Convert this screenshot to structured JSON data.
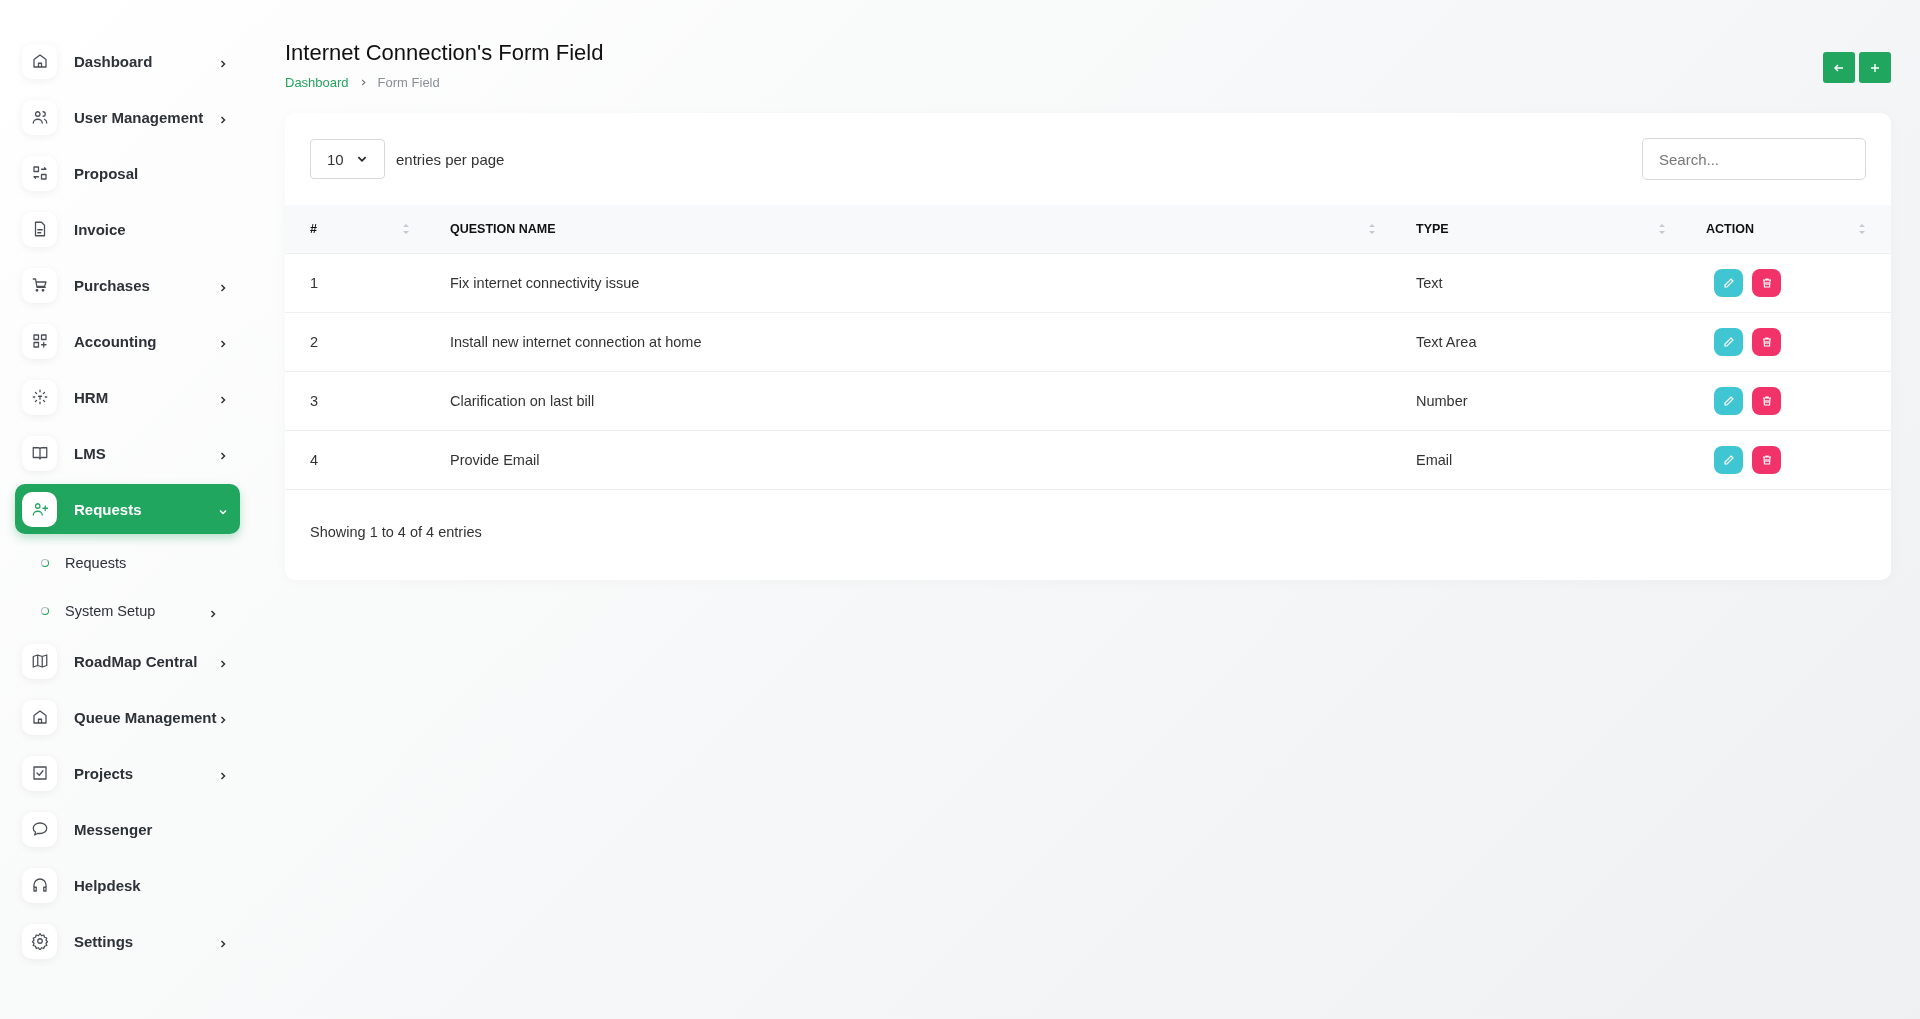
{
  "sidebar": {
    "items": [
      {
        "label": "Dashboard",
        "chevron": true,
        "selected": false
      },
      {
        "label": "User Management",
        "chevron": true,
        "selected": false
      },
      {
        "label": "Proposal",
        "chevron": false,
        "selected": false
      },
      {
        "label": "Invoice",
        "chevron": false,
        "selected": false
      },
      {
        "label": "Purchases",
        "chevron": true,
        "selected": false
      },
      {
        "label": "Accounting",
        "chevron": true,
        "selected": false
      },
      {
        "label": "HRM",
        "chevron": true,
        "selected": false
      },
      {
        "label": "LMS",
        "chevron": true,
        "selected": false
      },
      {
        "label": "Requests",
        "chevron": true,
        "selected": true,
        "expanded": true,
        "children": [
          {
            "label": "Requests",
            "chevron": false
          },
          {
            "label": "System Setup",
            "chevron": true
          }
        ]
      },
      {
        "label": "RoadMap Central",
        "chevron": true,
        "selected": false
      },
      {
        "label": "Queue Management",
        "chevron": true,
        "selected": false
      },
      {
        "label": "Projects",
        "chevron": true,
        "selected": false
      },
      {
        "label": "Messenger",
        "chevron": false,
        "selected": false
      },
      {
        "label": "Helpdesk",
        "chevron": false,
        "selected": false
      },
      {
        "label": "Settings",
        "chevron": true,
        "selected": false
      }
    ]
  },
  "page": {
    "title": "Internet Connection's Form Field",
    "breadcrumb": [
      "Dashboard",
      "Form Field"
    ]
  },
  "table_controls": {
    "page_size": "10",
    "page_size_label": "entries per page",
    "search": {
      "placeholder": "Search..."
    }
  },
  "table": {
    "columns": [
      "#",
      "QUESTION NAME",
      "TYPE",
      "ACTION"
    ],
    "rows": [
      {
        "number": "1",
        "question": "Fix internet connectivity issue",
        "type": "Text"
      },
      {
        "number": "2",
        "question": "Install new internet connection at home",
        "type": "Text Area"
      },
      {
        "number": "3",
        "question": "Clarification on last bill",
        "type": "Number"
      },
      {
        "number": "4",
        "question": "Provide Email",
        "type": "Email"
      }
    ]
  },
  "footer": "Showing 1 to 4 of 4 entries"
}
